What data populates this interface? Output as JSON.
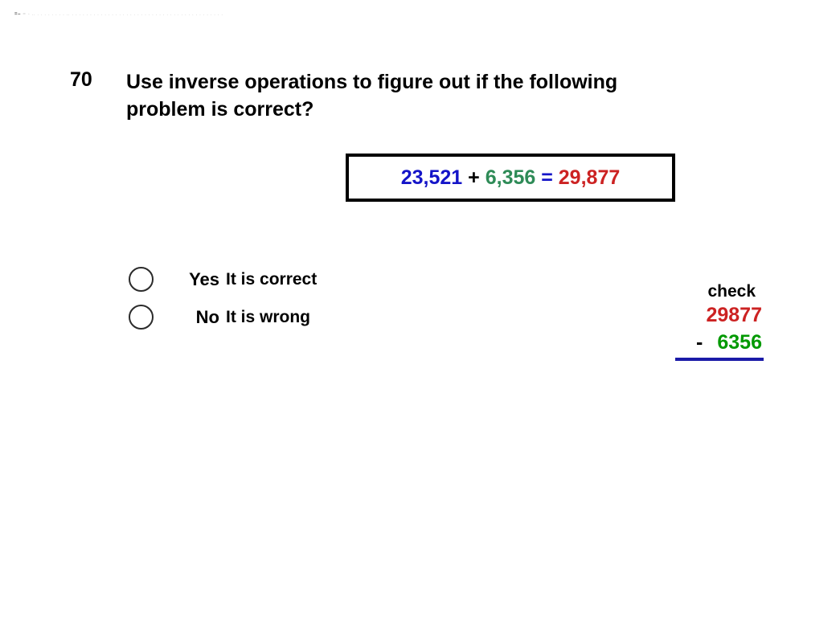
{
  "slide": {
    "background_color": "#ffffff",
    "artifact_strip": "= - .. . . . . . . . . .. . . . . . . . . . . . . . . . . . . . . . . . . . . . . . . . . . . . . . . . . . ."
  },
  "question": {
    "number": "70",
    "text": "Use inverse operations to figure out if the following problem is correct?"
  },
  "equation": {
    "addend_1": "23,521",
    "plus_sign": "+",
    "addend_2": "6,356",
    "equals_sign": "=",
    "sum": "29,877",
    "addend_1_color": "#1414c8",
    "addend_2_color": "#2e8b57",
    "sum_color": "#cc2222",
    "equals_color": "#1414c8",
    "plus_color": "#000000",
    "border_color": "#000000"
  },
  "answers": [
    {
      "key": "Yes",
      "description": "It is correct",
      "selected": false
    },
    {
      "key": "No",
      "description": "It is wrong",
      "selected": false
    }
  ],
  "check_work": {
    "label": "check",
    "minuend": "29877",
    "operator": "-",
    "subtrahend": "6356",
    "minuend_color": "#cc2222",
    "subtrahend_color": "#009900",
    "rule_color": "#1a1aa8"
  }
}
